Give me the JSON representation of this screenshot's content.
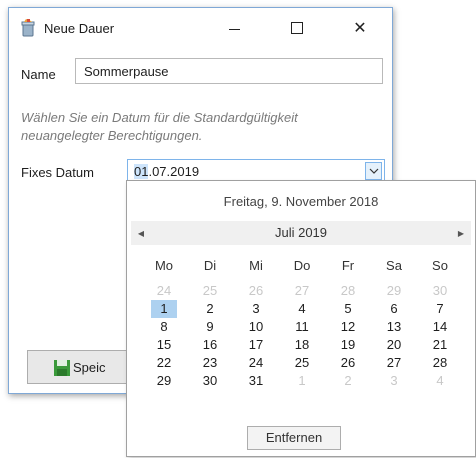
{
  "window": {
    "title": "Neue Dauer",
    "icon": "trash-bin-icon",
    "minimize_icon": "minimize-icon",
    "maximize_icon": "maximize-icon",
    "close_symbol": "✕"
  },
  "form": {
    "name_label": "Name",
    "name_value": "Sommerpause",
    "hint": "Wählen Sie ein Datum für die Standardgültigkeit neuangelegter Berechtigungen.",
    "fixed_date_label": "Fixes Datum",
    "date_value_selected": "01",
    "date_value_rest": ".07.2019",
    "dropdown_icon": "chevron-down-icon",
    "save_button_label": "Speic",
    "save_icon": "floppy-disk-icon"
  },
  "calendar": {
    "today_text": "Freitag, 9. November 2018",
    "month_label": "Juli 2019",
    "prev_symbol": "◀",
    "next_symbol": "▶",
    "weekdays": [
      "Mo",
      "Di",
      "Mi",
      "Do",
      "Fr",
      "Sa",
      "So"
    ],
    "days": [
      {
        "d": "24",
        "other": true
      },
      {
        "d": "25",
        "other": true
      },
      {
        "d": "26",
        "other": true
      },
      {
        "d": "27",
        "other": true
      },
      {
        "d": "28",
        "other": true
      },
      {
        "d": "29",
        "other": true
      },
      {
        "d": "30",
        "other": true
      },
      {
        "d": "1",
        "selected": true
      },
      {
        "d": "2"
      },
      {
        "d": "3"
      },
      {
        "d": "4"
      },
      {
        "d": "5"
      },
      {
        "d": "6"
      },
      {
        "d": "7"
      },
      {
        "d": "8"
      },
      {
        "d": "9"
      },
      {
        "d": "10"
      },
      {
        "d": "11"
      },
      {
        "d": "12"
      },
      {
        "d": "13"
      },
      {
        "d": "14"
      },
      {
        "d": "15"
      },
      {
        "d": "16"
      },
      {
        "d": "17"
      },
      {
        "d": "18"
      },
      {
        "d": "19"
      },
      {
        "d": "20"
      },
      {
        "d": "21"
      },
      {
        "d": "22"
      },
      {
        "d": "23"
      },
      {
        "d": "24"
      },
      {
        "d": "25"
      },
      {
        "d": "26"
      },
      {
        "d": "27"
      },
      {
        "d": "28"
      },
      {
        "d": "29"
      },
      {
        "d": "30"
      },
      {
        "d": "31"
      },
      {
        "d": "1",
        "other": true
      },
      {
        "d": "2",
        "other": true
      },
      {
        "d": "3",
        "other": true
      },
      {
        "d": "4",
        "other": true
      }
    ],
    "remove_button_label": "Entfernen"
  },
  "colors": {
    "window_border": "#7fa8d6",
    "selection": "#add1f0",
    "input_focus_border": "#7eb4ea",
    "muted_text": "#7a7a7a",
    "other_month_text": "#c8c8c8"
  }
}
